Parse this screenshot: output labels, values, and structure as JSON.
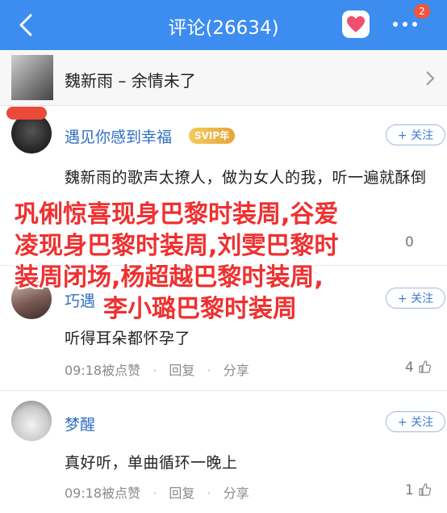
{
  "header": {
    "title": "评论(26634)",
    "badge_count": "2"
  },
  "song": {
    "title": "魏新雨 – 余情未了"
  },
  "comments": [
    {
      "name": "遇见你感到幸福",
      "vip_badge": "SVIP年",
      "follow_label": "+ 关注",
      "text": "魏新雨的歌声太撩人，做为女人的我，听一遍就酥倒",
      "partial_text": "就酥倒"
    },
    {
      "name": "巧遇",
      "follow_label": "+ 关注",
      "text": "听得耳朵都怀孕了",
      "time": "09:18被点赞",
      "reply": "回复",
      "share": "分享",
      "likes": "4"
    },
    {
      "name": "梦醒",
      "follow_label": "+ 关注",
      "text": "真好听，单曲循环一晚上",
      "time": "09:18被点赞",
      "reply": "回复",
      "share": "分享",
      "likes": "1"
    }
  ],
  "overlay": {
    "line1": "巩俐惊喜现身巴黎时装周,谷爱",
    "line2": "凌现身巴黎时装周,刘雯巴黎时",
    "line3": "装周闭场,杨超越巴黎时装周,",
    "line4": "李小璐巴黎时装周"
  },
  "colors": {
    "header_bg": "#3d8df0",
    "name": "#2f6fc4",
    "overlay_text": "#ef3030"
  }
}
